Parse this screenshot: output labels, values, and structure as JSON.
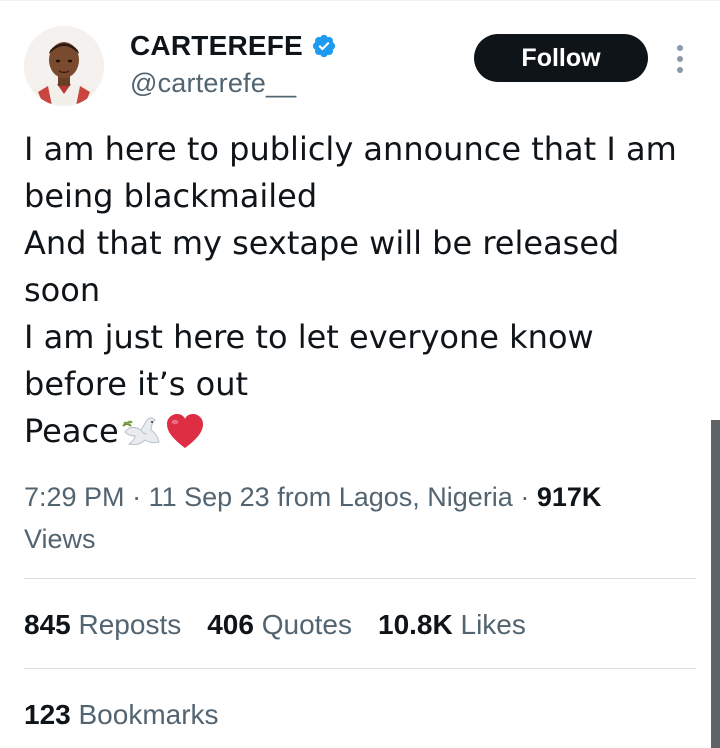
{
  "author": {
    "display_name": "CARTEREFE",
    "handle": "@carterefe__",
    "verified": true,
    "avatar": "profile-photo"
  },
  "follow_label": "Follow",
  "more_icon": "more-vertical-icon",
  "tweet": {
    "lines": [
      "I am here to publicly announce that I am",
      "being blackmailed",
      "And that my sextape will be released",
      "soon",
      "I am just here to let everyone know",
      "before it’s out"
    ],
    "last_line_text": "Peace",
    "emojis": [
      "dove-icon",
      "red-heart-icon"
    ]
  },
  "meta": {
    "time": "7:29 PM",
    "sep1": "·",
    "date": "11 Sep 23",
    "location_text": "from Lagos, Nigeria",
    "sep2": "·",
    "views_count": "917K",
    "views_label": "Views"
  },
  "stats": {
    "reposts_count": "845",
    "reposts_label": "Reposts",
    "quotes_count": "406",
    "quotes_label": "Quotes",
    "likes_count": "10.8K",
    "likes_label": "Likes",
    "bookmarks_count": "123",
    "bookmarks_label": "Bookmarks"
  },
  "colors": {
    "text_primary": "#0f1419",
    "text_secondary": "#536471",
    "verified_blue": "#1d9bf0",
    "follow_bg": "#0f1419",
    "heart_red": "#dd2e44"
  }
}
